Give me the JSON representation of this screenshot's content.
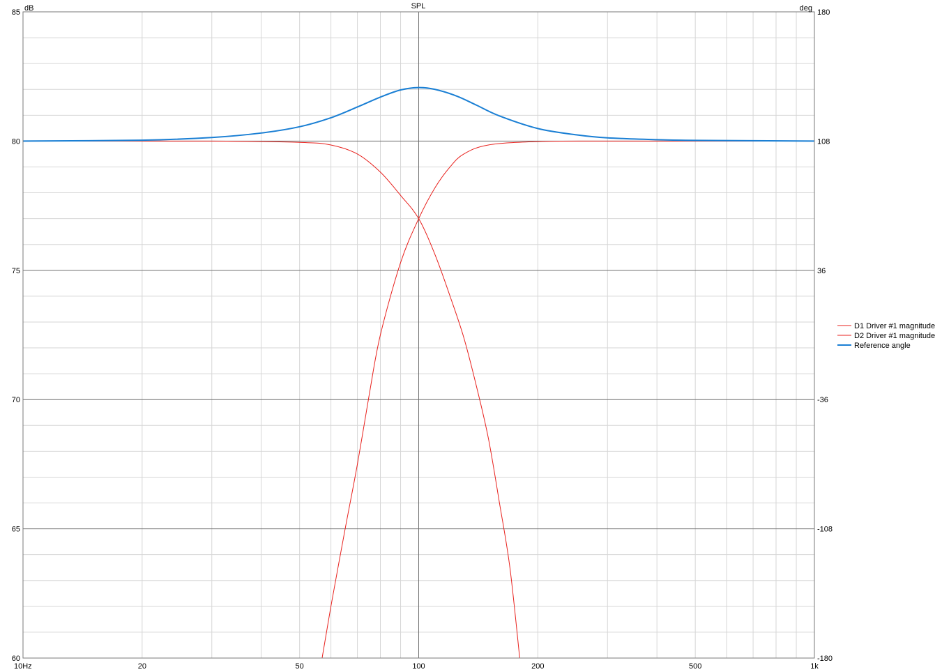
{
  "chart_data": {
    "type": "line",
    "title": "SPL",
    "x_scale": "log",
    "xlim": [
      10,
      1000
    ],
    "ylabel_left": "dB",
    "ylim_left": [
      60,
      85
    ],
    "ylabel_right": "deg",
    "ylim_right": [
      -180,
      180
    ],
    "x_tick_labels": [
      {
        "value": 10,
        "label": "10Hz"
      },
      {
        "value": 20,
        "label": "20"
      },
      {
        "value": 50,
        "label": "50"
      },
      {
        "value": 100,
        "label": "100"
      },
      {
        "value": 200,
        "label": "200"
      },
      {
        "value": 500,
        "label": "500"
      },
      {
        "value": 1000,
        "label": "1k"
      }
    ],
    "y_left_ticks": [
      {
        "value": 85,
        "label": "85"
      },
      {
        "value": 80,
        "label": "80"
      },
      {
        "value": 75,
        "label": "75"
      },
      {
        "value": 70,
        "label": "70"
      },
      {
        "value": 65,
        "label": "65"
      },
      {
        "value": 60,
        "label": "60"
      }
    ],
    "y_right_ticks": [
      {
        "value": 180,
        "label": "180"
      },
      {
        "value": 108,
        "label": "108"
      },
      {
        "value": 36,
        "label": "36"
      },
      {
        "value": -36,
        "label": "-36"
      },
      {
        "value": -108,
        "label": "-108"
      },
      {
        "value": -180,
        "label": "-180"
      }
    ],
    "grid": true,
    "legend_position": "right",
    "series": [
      {
        "name": "D1 Driver #1 magnitude",
        "color": "#e8201c",
        "axis": "left",
        "units": "dB",
        "x": [
          10,
          30,
          50,
          60,
          70,
          80,
          90,
          100,
          110,
          120,
          130,
          140,
          150,
          160,
          170,
          180
        ],
        "y": [
          80,
          80,
          79.95,
          79.85,
          79.5,
          78.8,
          77.9,
          77.0,
          75.6,
          74.0,
          72.4,
          70.5,
          68.5,
          66.0,
          63.5,
          60
        ]
      },
      {
        "name": "D2 Driver #1 magnitude",
        "color": "#e8201c",
        "axis": "left",
        "units": "dB",
        "x": [
          57,
          60,
          65,
          70,
          75,
          80,
          90,
          100,
          110,
          120,
          130,
          150,
          200,
          300,
          1000
        ],
        "y": [
          60,
          62.0,
          64.9,
          67.5,
          70.2,
          72.5,
          75.3,
          77.0,
          78.2,
          79.0,
          79.5,
          79.85,
          79.98,
          80,
          80
        ]
      },
      {
        "name": "Reference angle",
        "color": "#1a7fd4",
        "axis": "right",
        "units": "deg",
        "x": [
          10,
          20,
          30,
          40,
          50,
          60,
          70,
          80,
          90,
          100,
          110,
          125,
          140,
          160,
          200,
          250,
          300,
          400,
          500,
          1000
        ],
        "y": [
          108,
          108.5,
          110,
          112.5,
          116,
          121,
          127,
          132.5,
          136.5,
          137.8,
          136.8,
          133,
          128,
          122,
          115,
          111.5,
          109.8,
          108.8,
          108.4,
          108
        ]
      }
    ]
  }
}
